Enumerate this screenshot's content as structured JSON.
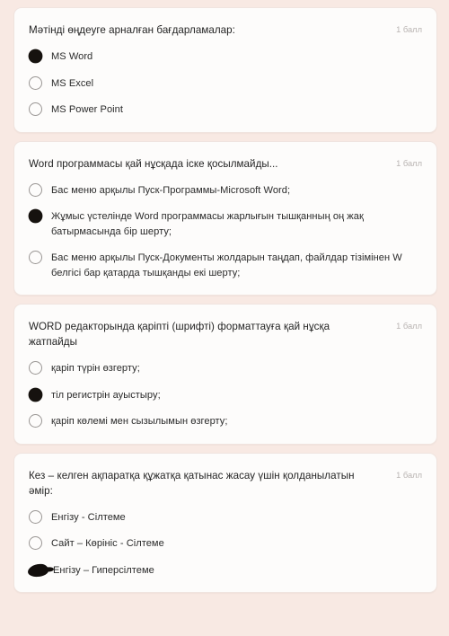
{
  "page": {
    "background_color": "#f8e9e3",
    "card_color": "#fdfcfb"
  },
  "questions": [
    {
      "title": "Мәтінді өңдеуге арналған бағдарламалар:",
      "points": "1 балл",
      "options": [
        {
          "label": "MS Word",
          "selected": true,
          "mark": "filled-circle"
        },
        {
          "label": "MS Excel",
          "selected": false,
          "mark": "empty-circle"
        },
        {
          "label": "MS Power Point",
          "selected": false,
          "mark": "empty-circle"
        }
      ]
    },
    {
      "title": "Word программасы қай нұсқада іске қосылмайды...",
      "points": "1 балл",
      "options": [
        {
          "label": "Бас меню арқылы Пуск-Программы-Microsoft Word;",
          "selected": false,
          "mark": "empty-circle"
        },
        {
          "label": "Жұмыс үстелінде Word программасы жарлығын тышқанның оң жақ батырмасында бір шерту;",
          "selected": true,
          "mark": "filled-circle"
        },
        {
          "label": "Бас меню арқылы Пуск-Документы жолдарын таңдап, файлдар тізімінен W белгісі бар қатарда тышқанды екі шерту;",
          "selected": false,
          "mark": "empty-circle"
        }
      ]
    },
    {
      "title": "WORD редакторында қаріпті (шрифті) форматтауға қай нұсқа жатпайды",
      "points": "1 балл",
      "options": [
        {
          "label": "қаріп түрін өзгерту;",
          "selected": false,
          "mark": "empty-circle"
        },
        {
          "label": "тіл регистрін ауыстыру;",
          "selected": true,
          "mark": "filled-circle"
        },
        {
          "label": "қаріп көлемі мен сызылымын өзгерту;",
          "selected": false,
          "mark": "empty-circle"
        }
      ]
    },
    {
      "title": "Кез – келген ақпаратқа құжатқа қатынас жасау үшін қолданылатын әмір:",
      "points": "1 балл",
      "options": [
        {
          "label": "Енгізу - Сілтеме",
          "selected": false,
          "mark": "empty-circle"
        },
        {
          "label": "Сайт – Көрініс - Сілтеме",
          "selected": false,
          "mark": "empty-circle"
        },
        {
          "label": "Енгізу – Гиперсілтеме",
          "selected": true,
          "mark": "ink-blob"
        }
      ]
    }
  ]
}
